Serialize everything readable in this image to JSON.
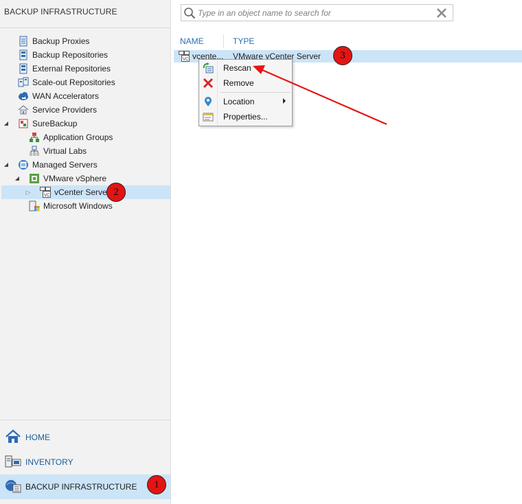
{
  "left_pane": {
    "title": "BACKUP INFRASTRUCTURE",
    "tree": [
      {
        "id": "backup-proxies",
        "label": "Backup Proxies",
        "icon": "backup-proxy-icon"
      },
      {
        "id": "backup-repositories",
        "label": "Backup Repositories",
        "icon": "repository-icon"
      },
      {
        "id": "external-repositories",
        "label": "External Repositories",
        "icon": "repository-icon"
      },
      {
        "id": "scale-out-repositories",
        "label": "Scale-out Repositories",
        "icon": "scale-out-repository-icon"
      },
      {
        "id": "wan-accelerators",
        "label": "WAN Accelerators",
        "icon": "wan-accelerator-icon"
      },
      {
        "id": "service-providers",
        "label": "Service Providers",
        "icon": "service-provider-icon"
      },
      {
        "id": "surebackup",
        "label": "SureBackup",
        "icon": "surebackup-icon"
      },
      {
        "id": "application-groups",
        "label": "Application Groups",
        "icon": "application-group-icon"
      },
      {
        "id": "virtual-labs",
        "label": "Virtual Labs",
        "icon": "virtual-lab-icon"
      },
      {
        "id": "managed-servers",
        "label": "Managed Servers",
        "icon": "managed-servers-icon"
      },
      {
        "id": "vmware-vsphere",
        "label": "VMware vSphere",
        "icon": "vsphere-icon"
      },
      {
        "id": "vcenter-servers",
        "label": "vCenter Servers",
        "icon": "vcenter-icon"
      },
      {
        "id": "microsoft-windows",
        "label": "Microsoft Windows",
        "icon": "windows-server-icon"
      }
    ],
    "nav": [
      {
        "id": "home",
        "label": "HOME",
        "icon": "home-icon"
      },
      {
        "id": "inventory",
        "label": "INVENTORY",
        "icon": "inventory-icon"
      },
      {
        "id": "backup-infrastructure",
        "label": "BACKUP INFRASTRUCTURE",
        "icon": "backup-infrastructure-icon",
        "active": true
      }
    ]
  },
  "search": {
    "placeholder": "Type in an object name to search for",
    "value": ""
  },
  "table": {
    "columns": [
      "NAME",
      "TYPE"
    ],
    "rows": [
      {
        "name": "vcente...",
        "type": "VMware vCenter Server"
      }
    ]
  },
  "context_menu": {
    "items": [
      {
        "id": "rescan",
        "label": "Rescan",
        "icon": "rescan-icon"
      },
      {
        "id": "remove",
        "label": "Remove",
        "icon": "remove-icon"
      },
      {
        "id": "location",
        "label": "Location",
        "icon": "location-pin-icon",
        "submenu": true
      },
      {
        "id": "properties",
        "label": "Properties...",
        "icon": "properties-icon"
      }
    ]
  },
  "callouts": [
    "1",
    "2",
    "3"
  ],
  "colors": {
    "selection": "#cce4f7",
    "link_blue": "#2a6fb0",
    "callout_red": "#e31414",
    "arrow_red": "#e81515"
  }
}
